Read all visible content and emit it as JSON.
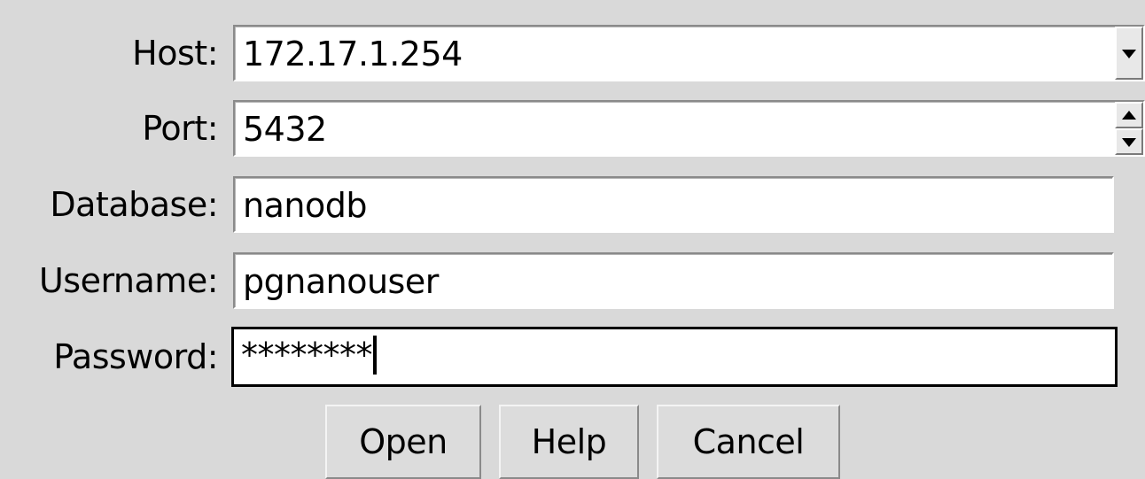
{
  "form": {
    "host": {
      "label": "Host:",
      "value": "172.17.1.254"
    },
    "port": {
      "label": "Port:",
      "value": "5432"
    },
    "database": {
      "label": "Database:",
      "value": "nanodb"
    },
    "username": {
      "label": "Username:",
      "value": "pgnanouser"
    },
    "password": {
      "label": "Password:",
      "value": "********"
    }
  },
  "buttons": {
    "open": "Open",
    "help": "Help",
    "cancel": "Cancel"
  },
  "icons": {
    "host_dropdown": "chevron-down-icon",
    "port_up": "spin-up-icon",
    "port_down": "spin-down-icon"
  }
}
